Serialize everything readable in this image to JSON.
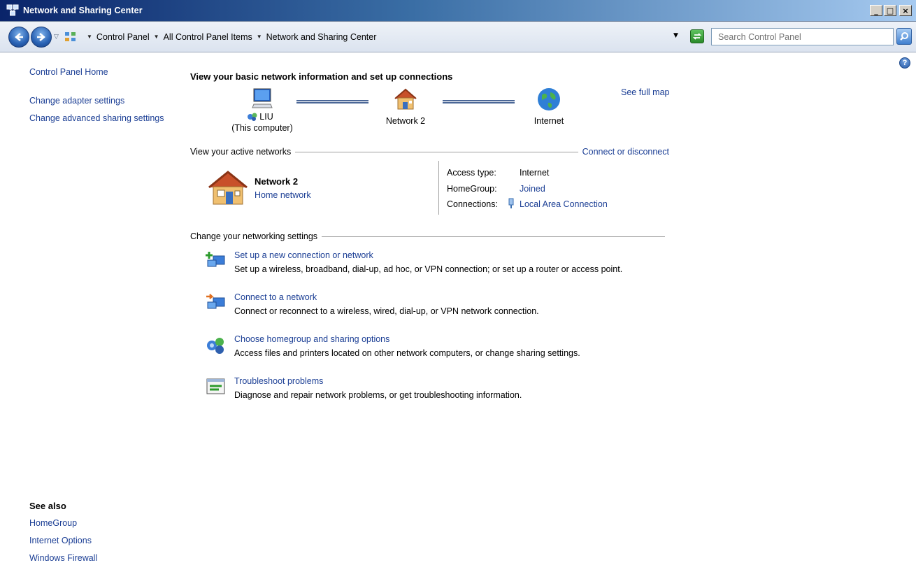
{
  "window": {
    "title": "Network and Sharing Center",
    "minimize": "_",
    "maximize": "□",
    "close": "×"
  },
  "address": {
    "crumbs": [
      "Control Panel",
      "All Control Panel Items",
      "Network and Sharing Center"
    ],
    "search_placeholder": "Search Control Panel"
  },
  "sidebar": {
    "items": [
      {
        "label": "Control Panel Home"
      },
      {
        "label": "Change adapter settings"
      },
      {
        "label": "Change advanced sharing settings"
      }
    ],
    "see_also_title": "See also",
    "see_also": [
      {
        "label": "HomeGroup"
      },
      {
        "label": "Internet Options"
      },
      {
        "label": "Windows Firewall"
      }
    ]
  },
  "main": {
    "title": "View your basic network information and set up connections",
    "see_full_map": "See full map",
    "map": {
      "computer_name": "LIU",
      "computer_sub": "(This computer)",
      "network": "Network  2",
      "internet": "Internet"
    },
    "active_networks": {
      "header": "View your active networks",
      "connect_link": "Connect or disconnect",
      "network_name": "Network  2",
      "network_type": "Home network",
      "access_type_label": "Access type:",
      "access_type_value": "Internet",
      "homegroup_label": "HomeGroup:",
      "homegroup_value": "Joined",
      "connections_label": "Connections:",
      "connections_value": "Local Area Connection"
    },
    "settings": {
      "header": "Change your networking settings",
      "tasks": [
        {
          "title": "Set up a new connection or network",
          "desc": "Set up a wireless, broadband, dial-up, ad hoc, or VPN connection; or set up a router or access point."
        },
        {
          "title": "Connect to a network",
          "desc": "Connect or reconnect to a wireless, wired, dial-up, or VPN network connection."
        },
        {
          "title": "Choose homegroup and sharing options",
          "desc": "Access files and printers located on other network computers, or change sharing settings."
        },
        {
          "title": "Troubleshoot problems",
          "desc": "Diagnose and repair network problems, or get troubleshooting information."
        }
      ]
    }
  },
  "colors": {
    "link": "#1c3f95",
    "titlebar_start": "#0a246a",
    "titlebar_end": "#a6caf0"
  }
}
